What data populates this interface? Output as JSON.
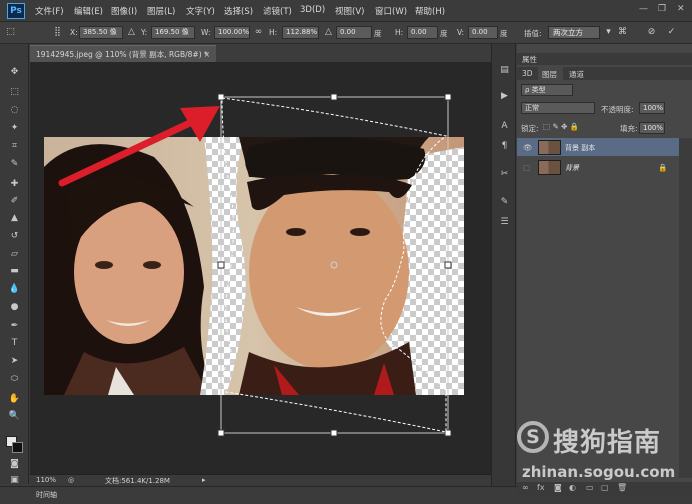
{
  "app": {
    "logo": "Ps"
  },
  "menu": [
    "文件(F)",
    "编辑(E)",
    "图像(I)",
    "图层(L)",
    "文字(Y)",
    "选择(S)",
    "滤镜(T)",
    "3D(D)",
    "视图(V)",
    "窗口(W)",
    "帮助(H)"
  ],
  "window_controls": {
    "minimize": "—",
    "restore": "❐",
    "close": "✕"
  },
  "options": {
    "x_label": "X:",
    "x_value": "385.50 像",
    "y_label": "Y:",
    "y_value": "169.50 像",
    "w_label": "W:",
    "w_value": "100.00%",
    "h_label": "H:",
    "h_value": "112.88%",
    "angle_value": "0.00",
    "hskew_label": "H:",
    "hskew_value": "0.00",
    "vskew_label": "V:",
    "vskew_value": "0.00",
    "interp_label": "插值:",
    "interp_value": "两次立方"
  },
  "document": {
    "tab_title": "19142945.jpeg @ 110% (背景 副本, RGB/8#) *",
    "tab_close": "×",
    "zoom": "110%",
    "doc_info": "文档:561.4K/1.28M",
    "timeline_label": "时间轴"
  },
  "panel": {
    "properties_label": "属性",
    "tabs": [
      "3D",
      "图层",
      "通道"
    ],
    "filter_label": "ρ 类型",
    "blend_mode": "正常",
    "opacity_label": "不透明度:",
    "opacity_value": "100%",
    "lock_label": "锁定:",
    "fill_label": "填充:",
    "fill_value": "100%",
    "layers": [
      {
        "name": "背景 副本",
        "selected": true
      },
      {
        "name": "背景",
        "selected": false
      }
    ]
  },
  "watermark": {
    "mark": "S",
    "title": "搜狗指南",
    "url": "zhinan.sogou.com"
  },
  "colors": {
    "accent": "#dc1e2a",
    "selected_layer": "#5a6b85"
  }
}
